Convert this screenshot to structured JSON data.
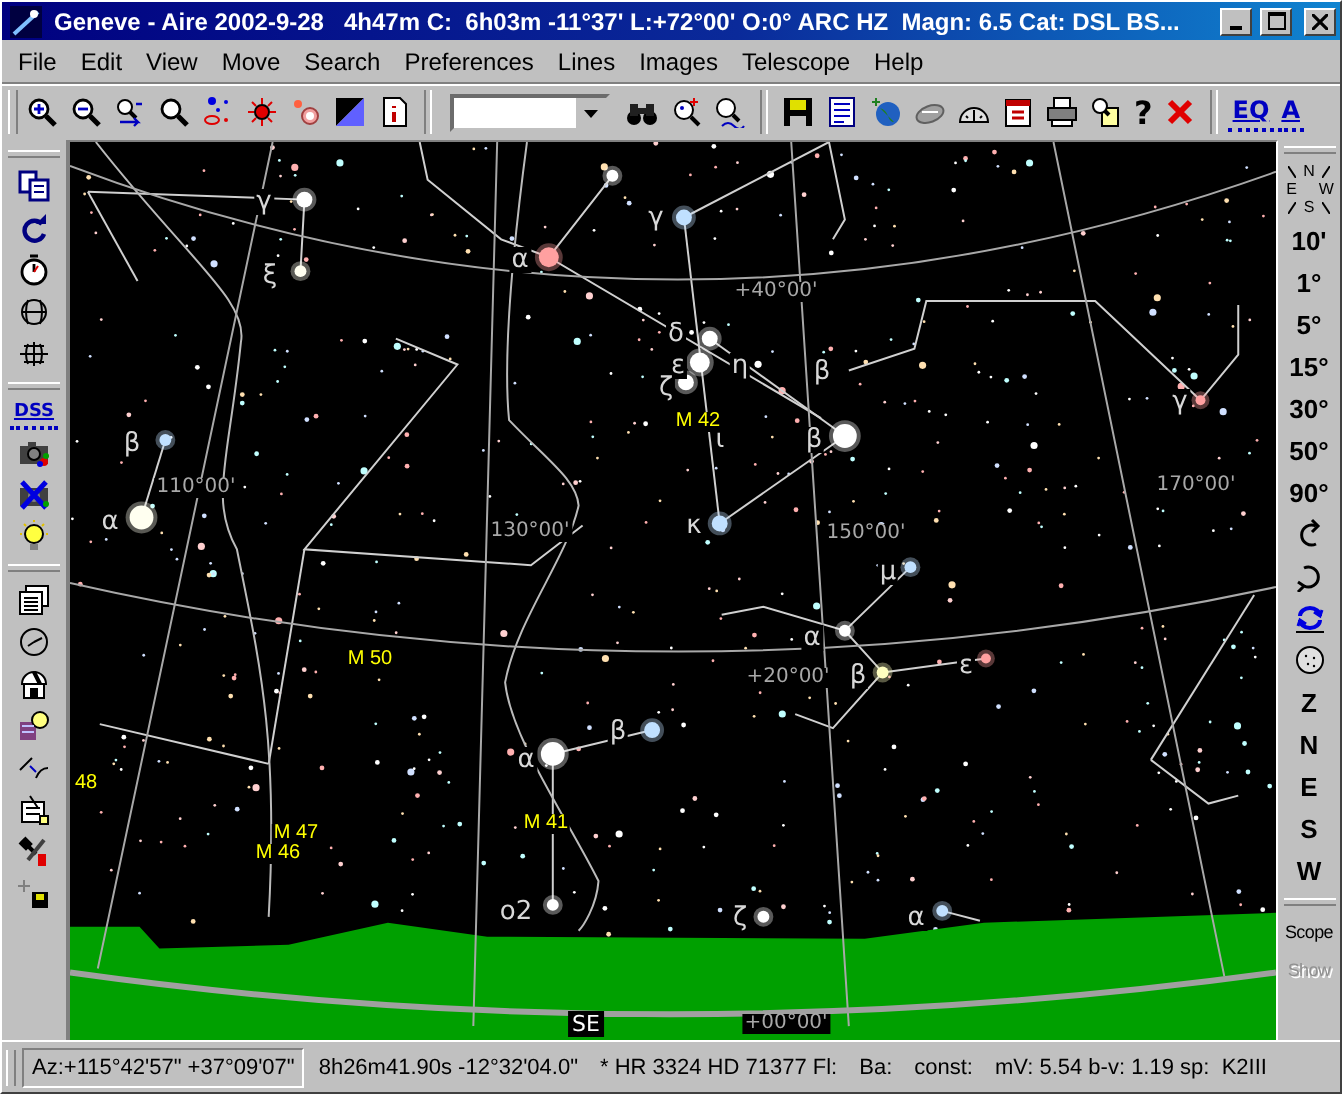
{
  "window": {
    "title": "Geneve - Aire 2002-9-28   4h47m C:  6h03m -11°37' L:+72°00' O:0° ARC HZ  Magn: 6.5 Cat: DSL BS..."
  },
  "menu": [
    "File",
    "Edit",
    "View",
    "Move",
    "Search",
    "Preferences",
    "Lines",
    "Images",
    "Telescope",
    "Help"
  ],
  "toolbar": {
    "help": "?",
    "projection_buttons": [
      "EQ",
      "A"
    ]
  },
  "left_toolbar": {
    "dss_label": "DSS"
  },
  "right_toolbar": {
    "compass": [
      "N",
      "E",
      "W",
      "S"
    ],
    "field_of_view": [
      "10'",
      "1°",
      "5°",
      "15°",
      "30°",
      "50°",
      "90°"
    ],
    "directions": [
      "Z",
      "N",
      "E",
      "S",
      "W"
    ],
    "scope_buttons": [
      {
        "label": "Scope",
        "disabled": false
      },
      {
        "label": "Show",
        "disabled": true
      }
    ]
  },
  "chart": {
    "labels": [
      {
        "text": "γ",
        "kind": "letter"
      },
      {
        "text": "ξ",
        "kind": "letter"
      },
      {
        "text": "α",
        "kind": "letter"
      },
      {
        "text": "γ",
        "kind": "letter"
      },
      {
        "text": "+40°00'",
        "kind": "grid"
      },
      {
        "text": "δ",
        "kind": "letter"
      },
      {
        "text": "ε",
        "kind": "letter"
      },
      {
        "text": "η",
        "kind": "letter"
      },
      {
        "text": "ζ",
        "kind": "letter"
      },
      {
        "text": "β",
        "kind": "letter"
      },
      {
        "text": "γ",
        "kind": "letter"
      },
      {
        "text": "β",
        "kind": "letter"
      },
      {
        "text": "M 42",
        "kind": "messier"
      },
      {
        "text": "ι",
        "kind": "letter"
      },
      {
        "text": "β",
        "kind": "letter"
      },
      {
        "text": "110°00'",
        "kind": "grid"
      },
      {
        "text": "170°00'",
        "kind": "grid"
      },
      {
        "text": "α",
        "kind": "letter"
      },
      {
        "text": "130°00'",
        "kind": "grid"
      },
      {
        "text": "κ",
        "kind": "letter"
      },
      {
        "text": "150°00'",
        "kind": "grid"
      },
      {
        "text": "μ",
        "kind": "letter"
      },
      {
        "text": "α",
        "kind": "letter"
      },
      {
        "text": "M 50",
        "kind": "messier"
      },
      {
        "text": "ε",
        "kind": "letter"
      },
      {
        "text": "+20°00'",
        "kind": "grid"
      },
      {
        "text": "β",
        "kind": "letter"
      },
      {
        "text": "β",
        "kind": "letter"
      },
      {
        "text": "α",
        "kind": "letter"
      },
      {
        "text": "48",
        "kind": "messier"
      },
      {
        "text": "M 47",
        "kind": "messier"
      },
      {
        "text": "M 41",
        "kind": "messier"
      },
      {
        "text": "M 46",
        "kind": "messier"
      },
      {
        "text": "o2",
        "kind": "letter"
      },
      {
        "text": "ζ",
        "kind": "letter"
      },
      {
        "text": "α",
        "kind": "letter"
      },
      {
        "text": "SE",
        "kind": "cardinal"
      },
      {
        "text": "+00°00'",
        "kind": "grid"
      }
    ]
  },
  "status_bar": {
    "fields": [
      "Az:+115°42'57\" +37°09'07\"",
      "8h26m41.90s -12°32'04.0\"",
      "* HR 3324 HD 71377 Fl:",
      "Ba:",
      "const:",
      "mV: 5.54 b-v: 1.19 sp:  K2III"
    ]
  }
}
